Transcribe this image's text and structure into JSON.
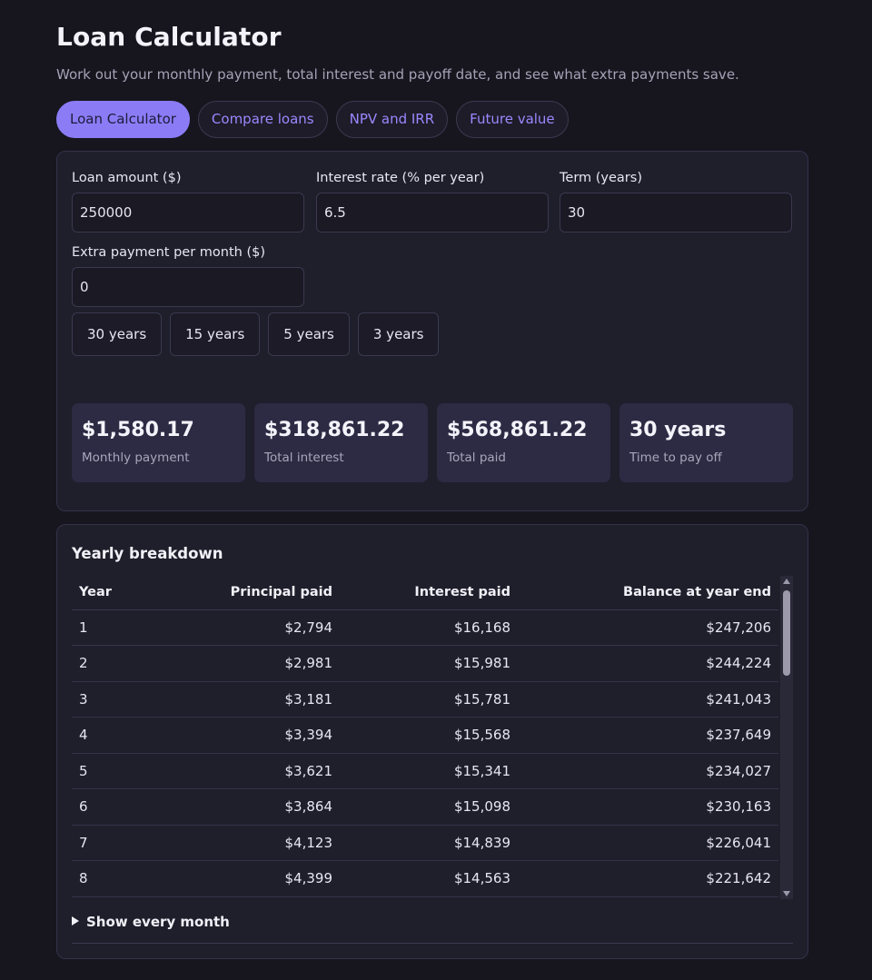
{
  "header": {
    "title": "Loan Calculator",
    "subtitle": "Work out your monthly payment, total interest and payoff date, and see what extra payments save."
  },
  "tabs": [
    {
      "label": "Loan Calculator",
      "active": true
    },
    {
      "label": "Compare loans",
      "active": false
    },
    {
      "label": "NPV and IRR",
      "active": false
    },
    {
      "label": "Future value",
      "active": false
    }
  ],
  "inputs": {
    "loan_amount": {
      "label": "Loan amount ($)",
      "value": "250000"
    },
    "interest_rate": {
      "label": "Interest rate (% per year)",
      "value": "6.5"
    },
    "term": {
      "label": "Term (years)",
      "value": "30"
    },
    "extra_payment": {
      "label": "Extra payment per month ($)",
      "value": "0"
    }
  },
  "presets": [
    "30 years",
    "15 years",
    "5 years",
    "3 years"
  ],
  "stats": [
    {
      "value": "$1,580.17",
      "label": "Monthly payment"
    },
    {
      "value": "$318,861.22",
      "label": "Total interest"
    },
    {
      "value": "$568,861.22",
      "label": "Total paid"
    },
    {
      "value": "30 years",
      "label": "Time to pay off"
    }
  ],
  "breakdown": {
    "title": "Yearly breakdown",
    "columns": [
      "Year",
      "Principal paid",
      "Interest paid",
      "Balance at year end"
    ],
    "rows": [
      [
        "1",
        "$2,794",
        "$16,168",
        "$247,206"
      ],
      [
        "2",
        "$2,981",
        "$15,981",
        "$244,224"
      ],
      [
        "3",
        "$3,181",
        "$15,781",
        "$241,043"
      ],
      [
        "4",
        "$3,394",
        "$15,568",
        "$237,649"
      ],
      [
        "5",
        "$3,621",
        "$15,341",
        "$234,027"
      ],
      [
        "6",
        "$3,864",
        "$15,098",
        "$230,163"
      ],
      [
        "7",
        "$4,123",
        "$14,839",
        "$226,041"
      ],
      [
        "8",
        "$4,399",
        "$14,563",
        "$221,642"
      ]
    ],
    "show_monthly_label": "Show every month"
  },
  "colors": {
    "accent": "#8b7cf6",
    "background": "#17161f",
    "card": "#1f1e2b",
    "stat_card": "#2d2a44"
  }
}
